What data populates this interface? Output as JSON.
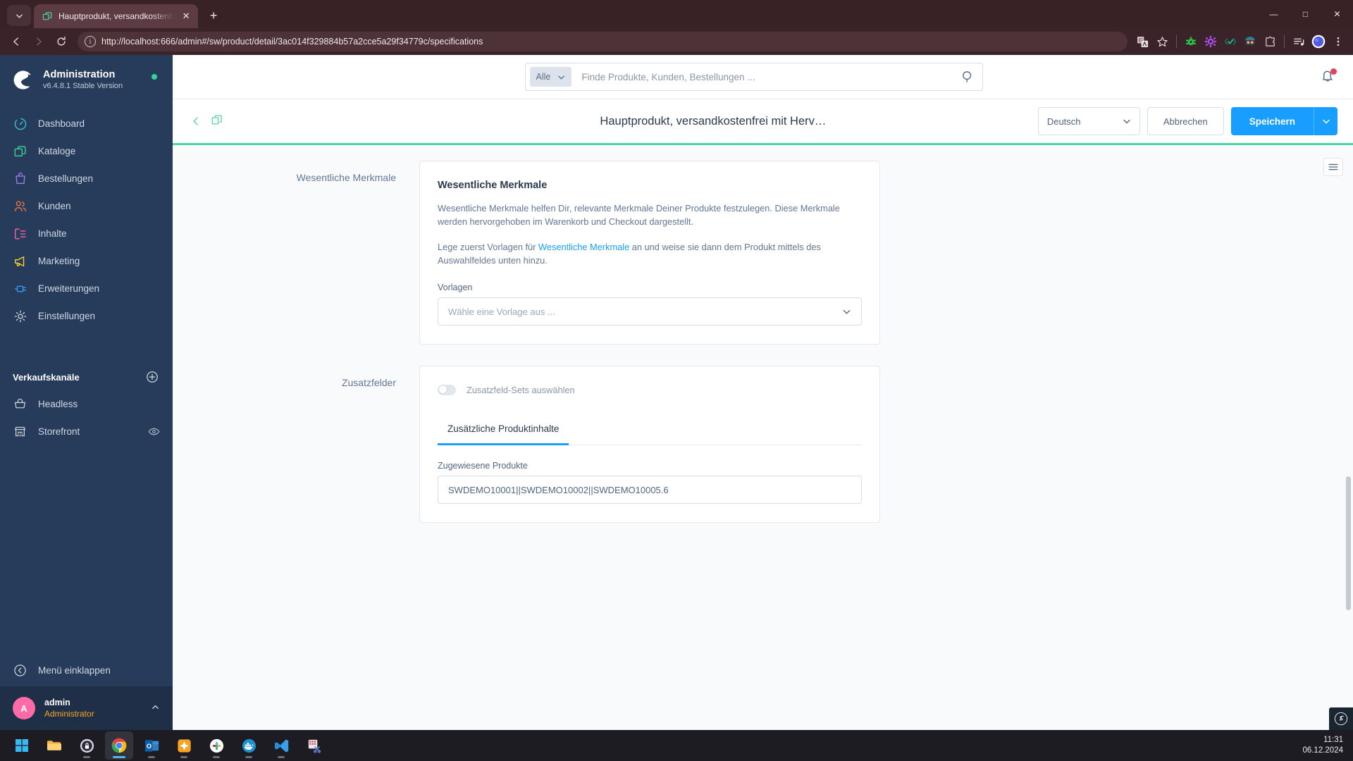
{
  "browser": {
    "tab": {
      "title": "Hauptprodukt, versandkostenfr",
      "favicon_icon": "shopware-catalog-icon",
      "close_icon": "close-icon"
    },
    "new_tab_label": "+",
    "tab_list_icon": "chevron-down-icon",
    "window_controls": {
      "minimize": "—",
      "maximize": "□",
      "close": "✕"
    },
    "nav": {
      "back_icon": "arrow-left-icon",
      "forward_icon": "arrow-right-icon",
      "reload_icon": "reload-icon"
    },
    "omnibox": {
      "info_icon": "info-circle-icon",
      "url": "http://localhost:666/admin#/sw/product/detail/3ac014f329884b57a2cce5a29f34779c/specifications"
    },
    "toolbar_icons": [
      "translate-icon",
      "bookmark-star-icon",
      "extension-bug-icon",
      "extension-gear-icon",
      "extension-check-icon",
      "extension-robot-icon",
      "puzzle-extensions-icon",
      "media-playlist-icon",
      "profile-avatar-icon",
      "three-dot-menu-icon"
    ]
  },
  "sidebar": {
    "brand": {
      "title": "Administration",
      "version": "v6.4.8.1 Stable Version",
      "logo_icon": "shopware-logo-icon",
      "status_dot_color": "#37d39b"
    },
    "items": [
      {
        "label": "Dashboard",
        "icon": "dashboard-gauge-icon",
        "color": "#37c3d8"
      },
      {
        "label": "Kataloge",
        "icon": "catalog-copy-icon",
        "color": "#3ed598"
      },
      {
        "label": "Bestellungen",
        "icon": "orders-bag-icon",
        "color": "#a07cf0"
      },
      {
        "label": "Kunden",
        "icon": "customers-people-icon",
        "color": "#f2753f"
      },
      {
        "label": "Inhalte",
        "icon": "content-layout-icon",
        "color": "#ff5fa8"
      },
      {
        "label": "Marketing",
        "icon": "marketing-megaphone-icon",
        "color": "#f8d32c"
      },
      {
        "label": "Erweiterungen",
        "icon": "extensions-plug-icon",
        "color": "#2f9bff"
      },
      {
        "label": "Einstellungen",
        "icon": "settings-gear-icon",
        "color": "#cfd7e3"
      }
    ],
    "sales_channels": {
      "title": "Verkaufskanäle",
      "add_icon": "plus-circle-icon",
      "items": [
        {
          "label": "Headless",
          "icon": "basket-icon",
          "has_eye": false
        },
        {
          "label": "Storefront",
          "icon": "storefront-icon",
          "has_eye": true,
          "eye_icon": "eye-icon"
        }
      ]
    },
    "collapse": {
      "label": "Menü einklappen",
      "icon": "chevron-left-circle-icon"
    },
    "user": {
      "avatar_initial": "A",
      "avatar_color": "#ff6ba6",
      "name": "admin",
      "role": "Administrator",
      "caret_icon": "chevron-up-icon"
    }
  },
  "topbar": {
    "search": {
      "scope_label": "Alle",
      "scope_caret_icon": "chevron-down-icon",
      "placeholder": "Finde Produkte, Kunden, Bestellungen ...",
      "value": "",
      "search_icon": "search-icon"
    },
    "notification": {
      "icon": "bell-icon",
      "badge_color": "#e0415b"
    }
  },
  "pagehead": {
    "back_icon": "chevron-left-icon",
    "duplicate_icon": "duplicate-icon",
    "title": "Hauptprodukt, versandkostenfrei mit Herv…",
    "language": {
      "value": "Deutsch",
      "caret_icon": "chevron-down-icon"
    },
    "cancel_label": "Abbrechen",
    "save_label": "Speichern",
    "save_caret_icon": "chevron-down-icon",
    "accent_color": "#189eff",
    "underline_color": "#4fd5a3"
  },
  "content": {
    "sidebar_toggle_icon": "list-settings-icon",
    "sections": [
      {
        "label": "Wesentliche Merkmale",
        "card_title": "Wesentliche Merkmale",
        "paragraph1": "Wesentliche Merkmale helfen Dir, relevante Merkmale Deiner Produkte festzulegen. Diese Merkmale werden hervorgehoben im Warenkorb und Checkout dargestellt.",
        "paragraph2_pre": "Lege zuerst Vorlagen für ",
        "paragraph2_link": "Wesentliche Merkmale",
        "paragraph2_post": " an und weise sie dann dem Produkt mittels des Auswahlfeldes unten hinzu.",
        "field_label": "Vorlagen",
        "select_placeholder": "Wähle eine Vorlage aus ...",
        "select_caret_icon": "chevron-down-icon"
      },
      {
        "label": "Zusatzfelder",
        "switch_label": "Zusatzfeld-Sets auswählen",
        "switch_state": "off",
        "tab_label": "Zusätzliche Produktinhalte",
        "field_label": "Zugewiesene Produkte",
        "field_value": "SWDEMO10001||SWDEMO10002||SWDEMO10005.6"
      }
    ],
    "symfony_badge_icon": "symfony-profiler-icon"
  },
  "taskbar": {
    "apps": [
      {
        "name": "start-windows-icon",
        "active": false,
        "running": false
      },
      {
        "name": "file-explorer-icon",
        "active": false,
        "running": false
      },
      {
        "name": "keepass-lock-icon",
        "active": false,
        "running": true
      },
      {
        "name": "google-chrome-icon",
        "active": true,
        "running": true
      },
      {
        "name": "outlook-icon",
        "active": false,
        "running": true
      },
      {
        "name": "orange-star-icon",
        "active": false,
        "running": true
      },
      {
        "name": "slack-icon",
        "active": false,
        "running": true
      },
      {
        "name": "docker-icon",
        "active": false,
        "running": true
      },
      {
        "name": "vscode-icon",
        "active": false,
        "running": true
      },
      {
        "name": "snipping-tool-icon",
        "active": false,
        "running": false
      }
    ],
    "clock": {
      "time": "11:31",
      "date": "06.12.2024"
    }
  }
}
